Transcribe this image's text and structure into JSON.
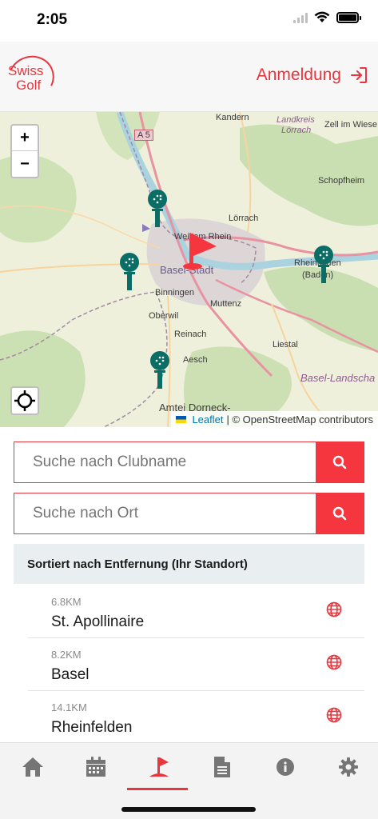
{
  "status": {
    "time": "2:05"
  },
  "header": {
    "logo_line1": "Swiss",
    "logo_line2": "Golf",
    "login_label": "Anmeldung"
  },
  "map": {
    "labels": {
      "kandern": "Kandern",
      "landkreis": "Landkreis",
      "loerrach_region": "Lörrach",
      "zell": "Zell im Wiese",
      "a5": "A 5",
      "schopfheim": "Schopfheim",
      "loerrach": "Lörrach",
      "weil": "Weil am Rhein",
      "basel_stadt": "Basel-Stadt",
      "rheinfelden": "Rheinfelden",
      "baden": "(Baden)",
      "binningen": "Binningen",
      "muttenz": "Muttenz",
      "oberwil": "Oberwil",
      "reinach": "Reinach",
      "liestal": "Liestal",
      "aesch": "Aesch",
      "basel_landschaft": "Basel-Landscha",
      "amtei": "Amtei Dorneck-"
    },
    "zoom_in": "+",
    "zoom_out": "−",
    "attribution_link": "Leaflet",
    "attribution_text": "| © OpenStreetMap contributors",
    "pin_color": "#0b6e66",
    "flag_color": "#f5363f"
  },
  "search": {
    "club_placeholder": "Suche nach Clubname",
    "place_placeholder": "Suche nach Ort"
  },
  "sort_label": "Sortiert nach Entfernung (Ihr Standort)",
  "clubs": [
    {
      "distance": "6.8KM",
      "name": "St. Apollinaire"
    },
    {
      "distance": "8.2KM",
      "name": "Basel"
    },
    {
      "distance": "14.1KM",
      "name": "Rheinfelden"
    }
  ],
  "colors": {
    "accent": "#e8363e",
    "button": "#f5363f",
    "tab_icon": "#757575"
  }
}
